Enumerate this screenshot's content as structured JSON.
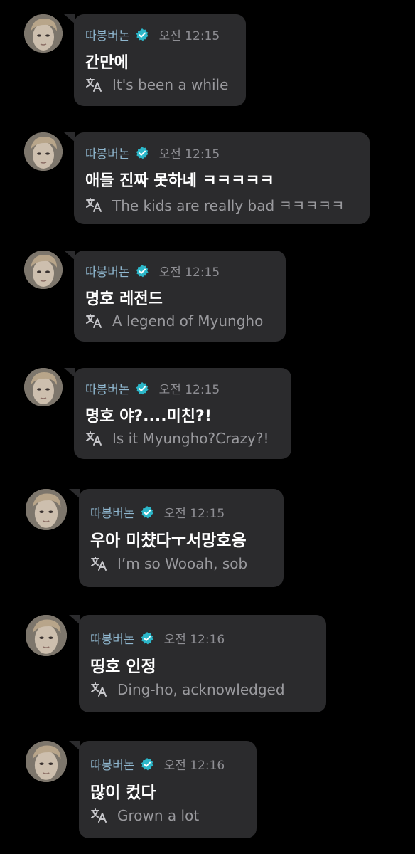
{
  "colors": {
    "background": "#000000",
    "bubble": "#2b2b2d",
    "sender": "#8fb7cf",
    "verified_badge": "#2cb7c9",
    "time": "#8e8e93",
    "message": "#ffffff",
    "translation": "#9a9a9e"
  },
  "icons": {
    "verified": "verified-badge-icon",
    "translate": "translate-icon",
    "avatar": "user-avatar"
  },
  "messages": [
    {
      "sender": "따봉버논",
      "time": "오전 12:15",
      "text": "간만에",
      "translation": "It's been a while"
    },
    {
      "sender": "따봉버논",
      "time": "오전 12:15",
      "text": "애들 진짜 못하네 ㅋㅋㅋㅋㅋ",
      "translation": "The kids are really bad ㅋㅋㅋㅋㅋ"
    },
    {
      "sender": "따봉버논",
      "time": "오전 12:15",
      "text": "명호 레전드",
      "translation": "A legend of Myungho"
    },
    {
      "sender": "따봉버논",
      "time": "오전 12:15",
      "text": "명호 야?....미친?!",
      "translation": "Is it Myungho?Crazy?!"
    },
    {
      "sender": "따봉버논",
      "time": "오전 12:15",
      "text": "우아 미챴다ㅜ서망호옹",
      "translation": "I’m so Wooah, sob"
    },
    {
      "sender": "따봉버논",
      "time": "오전 12:16",
      "text": "띵호 인정",
      "translation": "Ding-ho, acknowledged"
    },
    {
      "sender": "따봉버논",
      "time": "오전 12:16",
      "text": "많이 컸다",
      "translation": "Grown a lot"
    }
  ]
}
